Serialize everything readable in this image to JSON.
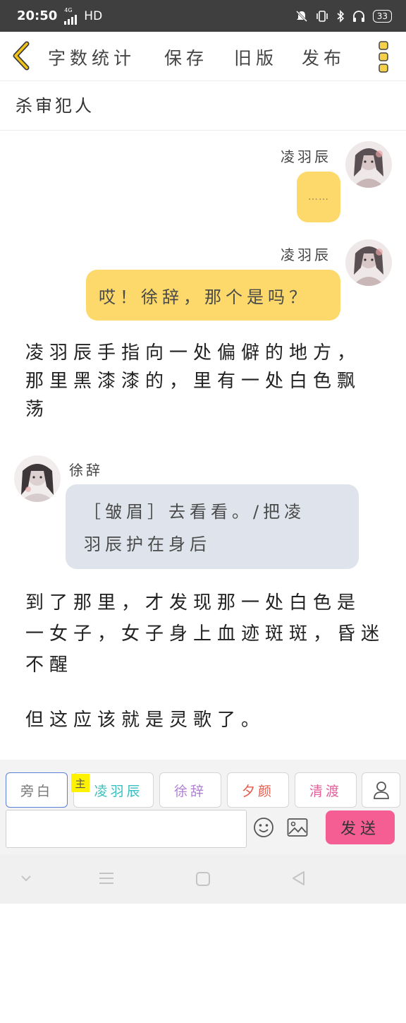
{
  "status_bar": {
    "time": "20:50",
    "network": "4G",
    "hd_label": "HD",
    "battery": "33"
  },
  "toolbar": {
    "word_count": "字数统计",
    "save": "保存",
    "old_version": "旧版",
    "publish": "发布"
  },
  "story": {
    "title": "杀审犯人"
  },
  "messages": [
    {
      "type": "dialog",
      "side": "right",
      "speaker": "凌羽辰",
      "text": "……"
    },
    {
      "type": "dialog",
      "side": "right",
      "speaker": "凌羽辰",
      "text": "哎！徐辞，那个是吗？"
    },
    {
      "type": "narration",
      "lines": [
        "凌羽辰手指向一处偏僻的地方，",
        "那里黑漆漆的，里有一处白色飘",
        "荡"
      ]
    },
    {
      "type": "dialog",
      "side": "left",
      "speaker": "徐辞",
      "lines": [
        "［皱眉］去看看。/把凌",
        "羽辰护在身后"
      ]
    },
    {
      "type": "narration",
      "lines": [
        "到了那里，才发现那一处白色是",
        "一女子，女子身上血迹斑斑，昏迷",
        "不醒"
      ]
    },
    {
      "type": "narration",
      "lines": [
        "但这应该就是灵歌了。"
      ]
    }
  ],
  "roles": [
    {
      "label": "旁白",
      "color": "#777777"
    },
    {
      "label": "凌羽辰",
      "color": "#3bbfbf",
      "main_tag": "主"
    },
    {
      "label": "徐辞",
      "color": "#b27fd6"
    },
    {
      "label": "夕颜",
      "color": "#e55a4a"
    },
    {
      "label": "清渡",
      "color": "#e0609a"
    }
  ],
  "composer": {
    "input_value": "",
    "send": "发送"
  },
  "icons": {
    "back": "chevron-left-icon",
    "menu": "more-vertical-icon",
    "add_role": "person-icon",
    "emoji": "emoji-icon",
    "image": "image-icon"
  },
  "colors": {
    "accent_yellow": "#fcd96a",
    "bubble_gray": "#dfe4ec",
    "send_pink": "#f45e93",
    "back_yellow": "#f2c419"
  }
}
